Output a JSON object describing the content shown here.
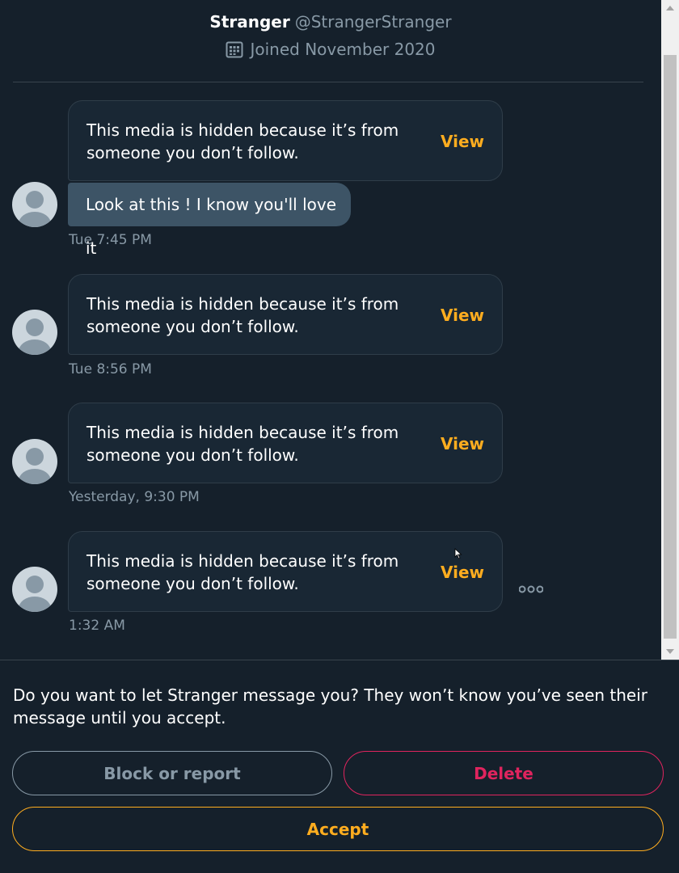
{
  "profile": {
    "name": "Stranger",
    "handle": "@StrangerStranger",
    "joined": "Joined November 2020"
  },
  "messages": [
    {
      "media_text": "This media is hidden because it’s from someone you don’t follow.",
      "view_label": "View",
      "text": "Look at this ! I know you'll love it",
      "time": "Tue 7:45 PM"
    },
    {
      "media_text": "This media is hidden because it’s from someone you don’t follow.",
      "view_label": "View",
      "time": "Tue 8:56 PM"
    },
    {
      "media_text": "This media is hidden because it’s from someone you don’t follow.",
      "view_label": "View",
      "time": "Yesterday, 9:30 PM"
    },
    {
      "media_text": "This media is hidden because it’s from someone you don’t follow.",
      "view_label": "View",
      "time": "1:32 AM"
    }
  ],
  "request": {
    "prompt": "Do you want to let Stranger message you? They won’t know you’ve seen their message until you accept.",
    "block_label": "Block or report",
    "delete_label": "Delete",
    "accept_label": "Accept"
  },
  "icons": {
    "calendar": "calendar-icon",
    "more": "more-options-icon",
    "avatar": "default-avatar-icon"
  },
  "colors": {
    "background": "#15202b",
    "accent": "#ffad1f",
    "danger": "#e0245e",
    "muted": "#8899a6"
  }
}
